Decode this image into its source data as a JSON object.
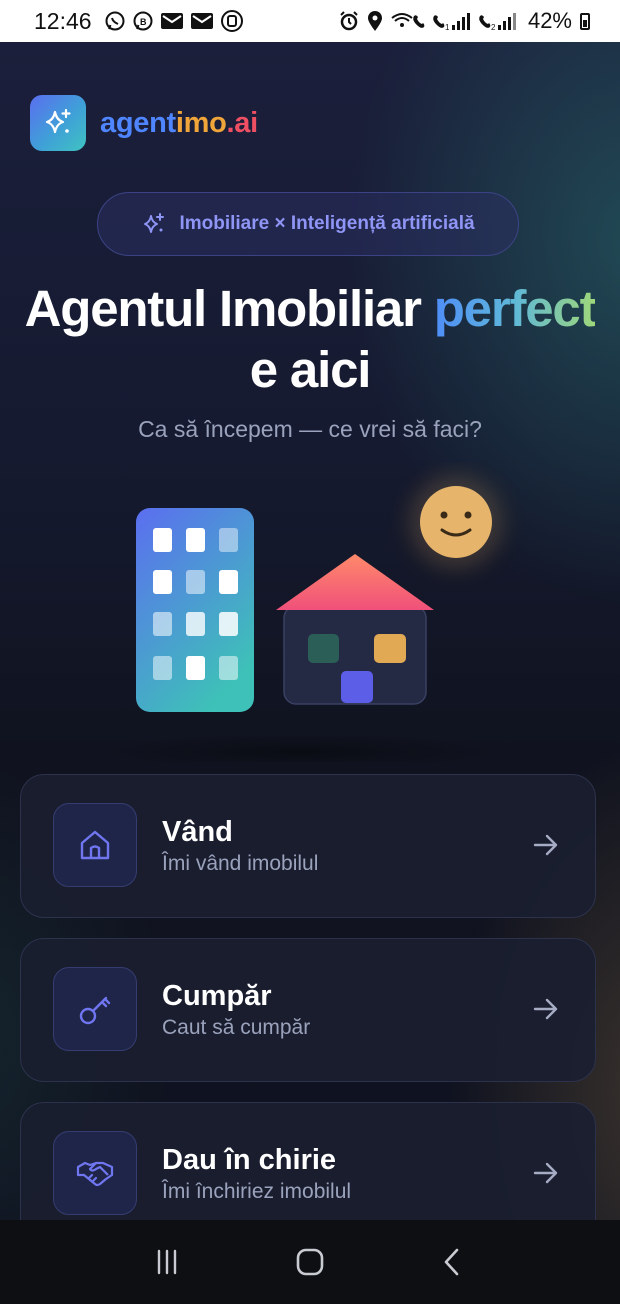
{
  "status_bar": {
    "time": "12:46",
    "battery": "42%",
    "left_icons": [
      "whatsapp-icon",
      "whatsapp-business-icon",
      "gmail-icon",
      "gmail-icon",
      "outlook-icon"
    ],
    "right_icons": [
      "alarm-icon",
      "location-icon",
      "wifi-calling-icon",
      "signal-sim1-icon",
      "signal-sim2-icon",
      "battery-icon"
    ]
  },
  "brand": {
    "part1": "agent",
    "part2": "imo",
    "part3": ".ai",
    "colors": {
      "part1": "#4f86ff",
      "part2": "#f0a53a",
      "part3": "#ef4f63"
    }
  },
  "tagline_pill": "Imobiliare × Inteligență artificială",
  "headline": {
    "line1_prefix": "Agentul Imobiliar",
    "line1_accent": "perfect",
    "line2": "e aici"
  },
  "subheadline": "Ca să începem — ce vrei să faci?",
  "options": [
    {
      "title": "Vând",
      "subtitle": "Îmi vând imobilul",
      "icon": "house-icon"
    },
    {
      "title": "Cumpăr",
      "subtitle": "Caut să cumpăr",
      "icon": "key-icon"
    },
    {
      "title": "Dau în chirie",
      "subtitle": "Îmi închiriez imobilul",
      "icon": "handshake-icon"
    }
  ],
  "nav": [
    "recents-icon",
    "home-icon",
    "back-icon"
  ],
  "colors": {
    "accent": "#8f95f5",
    "background": "#151a30",
    "card": "#1a1e30"
  }
}
